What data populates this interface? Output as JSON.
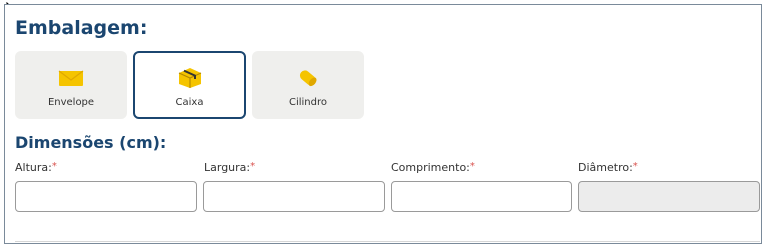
{
  "embalagem": {
    "title": "Embalagem:",
    "options": [
      {
        "label": "Envelope",
        "icon": "envelope-icon",
        "selected": false
      },
      {
        "label": "Caixa",
        "icon": "box-icon",
        "selected": true
      },
      {
        "label": "Cilindro",
        "icon": "cylinder-icon",
        "selected": false
      }
    ]
  },
  "dimensoes": {
    "title": "Dimensões (cm):",
    "fields": [
      {
        "label": "Altura:",
        "required_mark": "*",
        "value": "",
        "disabled": false
      },
      {
        "label": "Largura:",
        "required_mark": "*",
        "value": "",
        "disabled": false
      },
      {
        "label": "Comprimento:",
        "required_mark": "*",
        "value": "",
        "disabled": false
      },
      {
        "label": "Diâmetro:",
        "required_mark": "*",
        "value": "",
        "disabled": true
      }
    ]
  },
  "colors": {
    "title": "#1b4670",
    "selected_border": "#1b4670",
    "option_background": "#efefed",
    "icon_yellow": "#f5c400",
    "required": "#d9534f",
    "disabled_field": "#ececec"
  }
}
